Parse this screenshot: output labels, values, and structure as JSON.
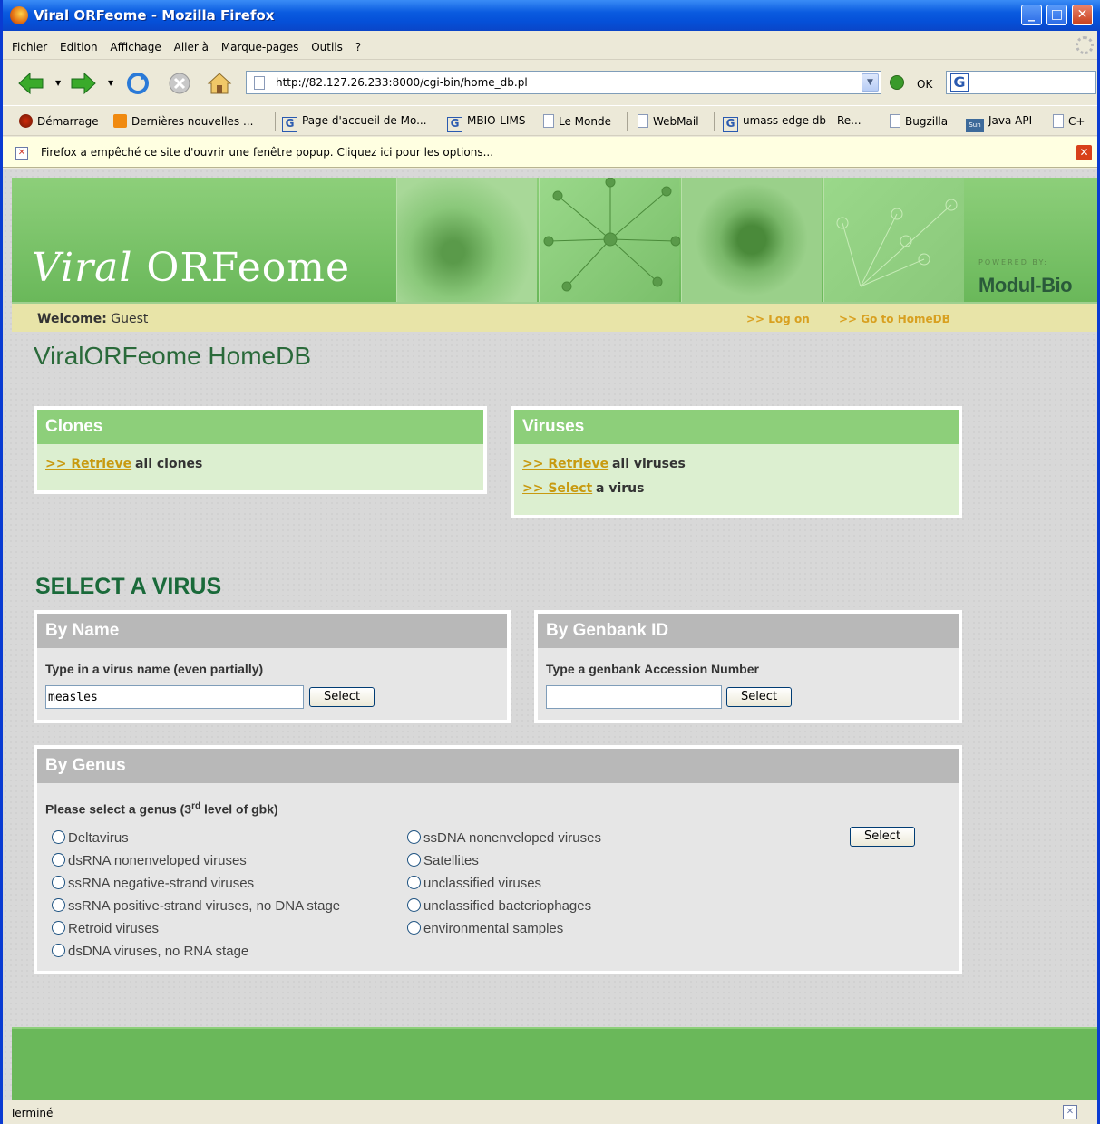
{
  "window": {
    "title": "Viral ORFeome - Mozilla Firefox"
  },
  "menu": [
    "Fichier",
    "Edition",
    "Affichage",
    "Aller à",
    "Marque-pages",
    "Outils",
    "?"
  ],
  "nav": {
    "url": "http://82.127.26.233:8000/cgi-bin/home_db.pl",
    "go_label": "OK",
    "search_engine": "G"
  },
  "bookmarks": [
    {
      "label": "Démarrage",
      "icon": "fire"
    },
    {
      "label": "Dernières nouvelles ...",
      "icon": "rss"
    },
    {
      "label": "Page d'accueil de Mo...",
      "icon": "goog"
    },
    {
      "label": "MBIO-LIMS",
      "icon": "goog"
    },
    {
      "label": "Le Monde",
      "icon": "page"
    },
    {
      "label": "WebMail",
      "icon": "page"
    },
    {
      "label": "umass edge db - Re...",
      "icon": "goog"
    },
    {
      "label": "Bugzilla",
      "icon": "page"
    },
    {
      "label": "Java API",
      "icon": "sun"
    },
    {
      "label": "C+",
      "icon": "page"
    }
  ],
  "popup": {
    "message": "Firefox a empêché ce site d'ouvrir une fenêtre popup. Cliquez ici pour les options..."
  },
  "banner": {
    "logo_italic": "Viral",
    "logo_rest": " ORFeome",
    "powered_by": "POWERED BY:",
    "brand": "Modul-Bio"
  },
  "welcome": {
    "label": "Welcome:",
    "user": "Guest",
    "links": [
      ">> Log on",
      ">> Go to HomeDB"
    ]
  },
  "page": {
    "title": "ViralORFeome HomeDB",
    "section_title": "SELECT A VIRUS"
  },
  "clones": {
    "header": "Clones",
    "retrieve_link": ">> Retrieve",
    "retrieve_text": "all clones"
  },
  "viruses": {
    "header": "Viruses",
    "retrieve_link": ">> Retrieve",
    "retrieve_text": "all viruses",
    "select_link": ">> Select",
    "select_text": "a virus"
  },
  "by_name": {
    "header": "By Name",
    "label": "Type in a virus name (even partially)",
    "value": "measles",
    "button": "Select"
  },
  "by_genbank": {
    "header": "By Genbank ID",
    "label": "Type a genbank Accession Number",
    "value": "",
    "button": "Select"
  },
  "by_genus": {
    "header": "By Genus",
    "label_pre": "Please select a genus (3",
    "label_sup": "rd",
    "label_post": " level of gbk)",
    "button": "Select",
    "col1": [
      "Deltavirus",
      "dsRNA nonenveloped viruses",
      "ssRNA negative-strand viruses",
      "ssRNA positive-strand viruses, no DNA stage",
      "Retroid viruses",
      "dsDNA viruses, no RNA stage"
    ],
    "col2": [
      "ssDNA nonenveloped viruses",
      "Satellites",
      "unclassified viruses",
      "unclassified bacteriophages",
      "environmental samples"
    ]
  },
  "status": {
    "text": "Terminé"
  }
}
